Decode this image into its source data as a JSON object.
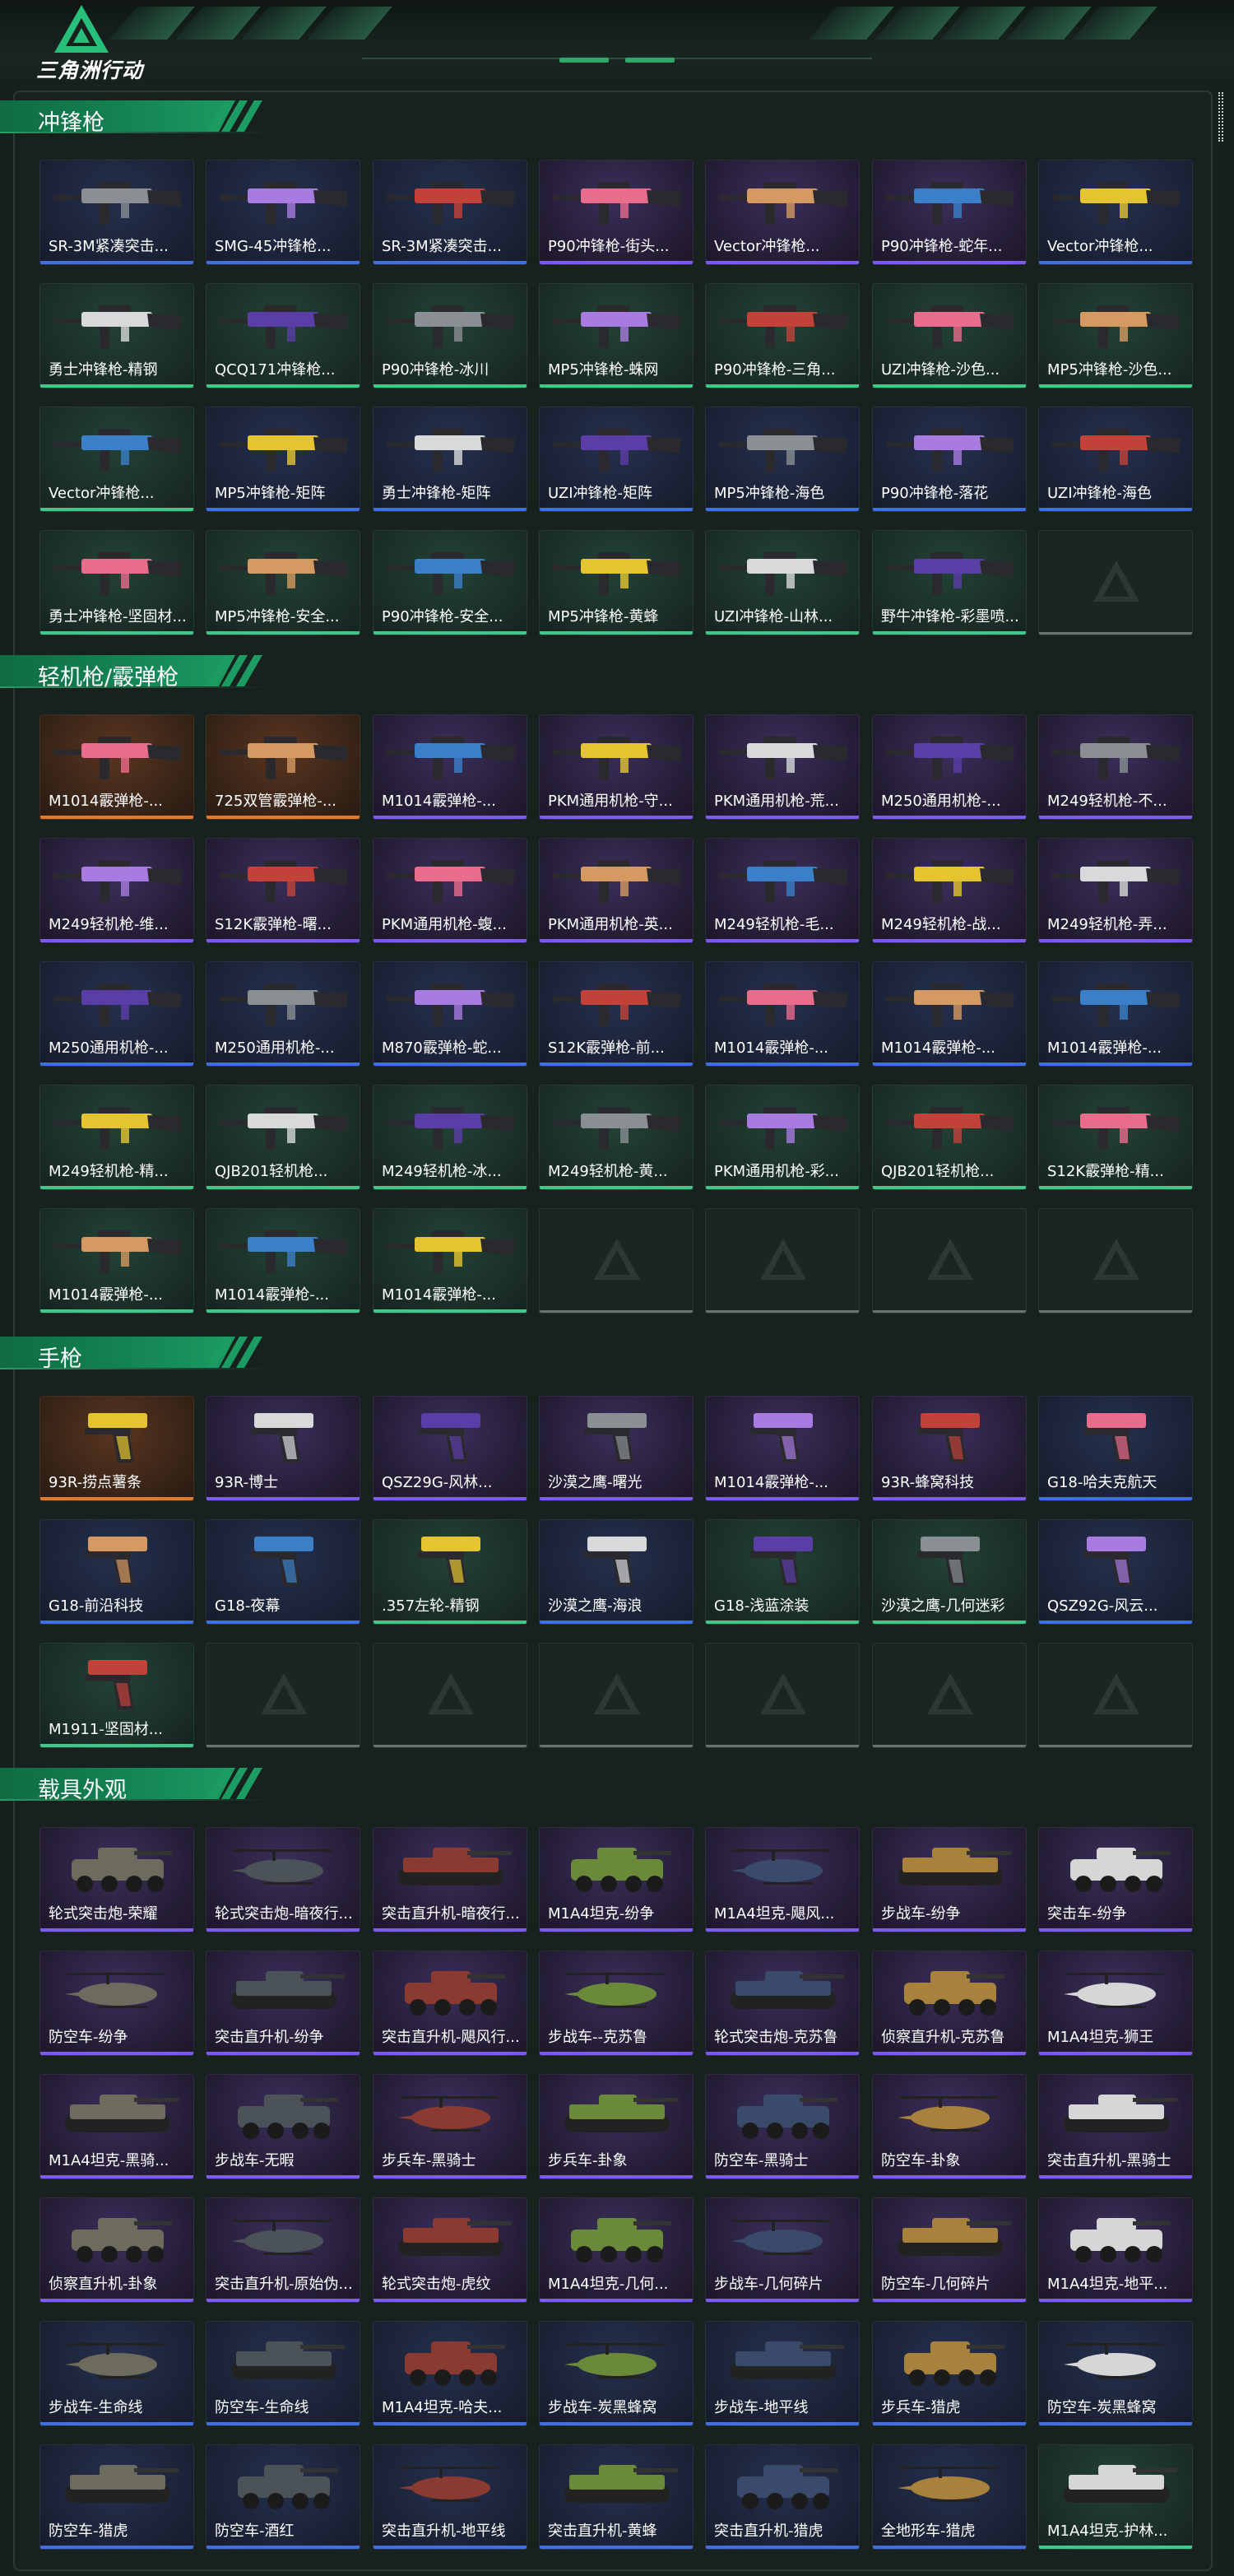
{
  "logo_text": "三角洲行动",
  "colors": {
    "purple": "#7b5cf0",
    "blue": "#3f6fe0",
    "green": "#3ec889",
    "orange": "#e27a2c",
    "accent": "#148454"
  },
  "sections": [
    {
      "title": "冲锋枪",
      "kind": "gun",
      "items": [
        {
          "label": "SR-3M紧凑突击...",
          "rarity": "blue"
        },
        {
          "label": "SMG-45冲锋枪...",
          "rarity": "blue"
        },
        {
          "label": "SR-3M紧凑突击...",
          "rarity": "blue"
        },
        {
          "label": "P90冲锋枪-街头...",
          "rarity": "purple"
        },
        {
          "label": "Vector冲锋枪...",
          "rarity": "purple"
        },
        {
          "label": "P90冲锋枪-蛇年...",
          "rarity": "purple"
        },
        {
          "label": "Vector冲锋枪...",
          "rarity": "blue"
        },
        {
          "label": "勇士冲锋枪-精钢",
          "rarity": "green"
        },
        {
          "label": "QCQ171冲锋枪...",
          "rarity": "green"
        },
        {
          "label": "P90冲锋枪-冰川",
          "rarity": "green"
        },
        {
          "label": "MP5冲锋枪-蛛网",
          "rarity": "green"
        },
        {
          "label": "P90冲锋枪-三角...",
          "rarity": "green"
        },
        {
          "label": "UZI冲锋枪-沙色...",
          "rarity": "green"
        },
        {
          "label": "MP5冲锋枪-沙色...",
          "rarity": "green"
        },
        {
          "label": "Vector冲锋枪...",
          "rarity": "green"
        },
        {
          "label": "MP5冲锋枪-矩阵",
          "rarity": "blue"
        },
        {
          "label": "勇士冲锋枪-矩阵",
          "rarity": "blue"
        },
        {
          "label": "UZI冲锋枪-矩阵",
          "rarity": "blue"
        },
        {
          "label": "MP5冲锋枪-海色",
          "rarity": "blue"
        },
        {
          "label": "P90冲锋枪-落花",
          "rarity": "blue"
        },
        {
          "label": "UZI冲锋枪-海色",
          "rarity": "blue"
        },
        {
          "label": "勇士冲锋枪-坚固材...",
          "rarity": "green"
        },
        {
          "label": "MP5冲锋枪-安全...",
          "rarity": "green"
        },
        {
          "label": "P90冲锋枪-安全...",
          "rarity": "green"
        },
        {
          "label": "MP5冲锋枪-黄蜂",
          "rarity": "green"
        },
        {
          "label": "UZI冲锋枪-山林...",
          "rarity": "green"
        },
        {
          "label": "野牛冲锋枪-彩墨喷...",
          "rarity": "green"
        },
        {
          "label": "",
          "rarity": "empty"
        }
      ]
    },
    {
      "title": "轻机枪/霰弹枪",
      "kind": "gun",
      "items": [
        {
          "label": "M1014霰弹枪-...",
          "rarity": "orange"
        },
        {
          "label": "725双管霰弹枪-...",
          "rarity": "orange"
        },
        {
          "label": "M1014霰弹枪-...",
          "rarity": "purple"
        },
        {
          "label": "PKM通用机枪-守...",
          "rarity": "purple"
        },
        {
          "label": "PKM通用机枪-荒...",
          "rarity": "purple"
        },
        {
          "label": "M250通用机枪-...",
          "rarity": "purple"
        },
        {
          "label": "M249轻机枪-不...",
          "rarity": "purple"
        },
        {
          "label": "M249轻机枪-维...",
          "rarity": "purple"
        },
        {
          "label": "S12K霰弹枪-曙...",
          "rarity": "purple"
        },
        {
          "label": "PKM通用机枪-蝮...",
          "rarity": "purple"
        },
        {
          "label": "PKM通用机枪-英...",
          "rarity": "purple"
        },
        {
          "label": "M249轻机枪-毛...",
          "rarity": "purple"
        },
        {
          "label": "M249轻机枪-战...",
          "rarity": "purple"
        },
        {
          "label": "M249轻机枪-弄...",
          "rarity": "purple"
        },
        {
          "label": "M250通用机枪-...",
          "rarity": "blue"
        },
        {
          "label": "M250通用机枪-...",
          "rarity": "blue"
        },
        {
          "label": "M870霰弹枪-蛇...",
          "rarity": "blue"
        },
        {
          "label": "S12K霰弹枪-前...",
          "rarity": "blue"
        },
        {
          "label": "M1014霰弹枪-...",
          "rarity": "blue"
        },
        {
          "label": "M1014霰弹枪-...",
          "rarity": "blue"
        },
        {
          "label": "M1014霰弹枪-...",
          "rarity": "blue"
        },
        {
          "label": "M249轻机枪-精...",
          "rarity": "green"
        },
        {
          "label": "QJB201轻机枪...",
          "rarity": "green"
        },
        {
          "label": "M249轻机枪-冰...",
          "rarity": "green"
        },
        {
          "label": "M249轻机枪-黄...",
          "rarity": "green"
        },
        {
          "label": "PKM通用机枪-彩...",
          "rarity": "green"
        },
        {
          "label": "QJB201轻机枪...",
          "rarity": "green"
        },
        {
          "label": "S12K霰弹枪-精...",
          "rarity": "green"
        },
        {
          "label": "M1014霰弹枪-...",
          "rarity": "green"
        },
        {
          "label": "M1014霰弹枪-...",
          "rarity": "green"
        },
        {
          "label": "M1014霰弹枪-...",
          "rarity": "green"
        },
        {
          "label": "",
          "rarity": "empty"
        },
        {
          "label": "",
          "rarity": "empty"
        },
        {
          "label": "",
          "rarity": "empty"
        },
        {
          "label": "",
          "rarity": "empty"
        }
      ]
    },
    {
      "title": "手枪",
      "kind": "pistol",
      "items": [
        {
          "label": "93R-捞点薯条",
          "rarity": "orange"
        },
        {
          "label": "93R-博士",
          "rarity": "purple"
        },
        {
          "label": "QSZ29G-风林...",
          "rarity": "purple"
        },
        {
          "label": "沙漠之鹰-曙光",
          "rarity": "purple"
        },
        {
          "label": "M1014霰弹枪-...",
          "rarity": "purple"
        },
        {
          "label": "93R-蜂窝科技",
          "rarity": "purple"
        },
        {
          "label": "G18-哈夫克航天",
          "rarity": "blue"
        },
        {
          "label": "G18-前沿科技",
          "rarity": "blue"
        },
        {
          "label": "G18-夜幕",
          "rarity": "blue"
        },
        {
          "label": ".357左轮-精钢",
          "rarity": "green"
        },
        {
          "label": "沙漠之鹰-海浪",
          "rarity": "blue"
        },
        {
          "label": "G18-浅蓝涂装",
          "rarity": "green"
        },
        {
          "label": "沙漠之鹰-几何迷彩",
          "rarity": "green"
        },
        {
          "label": "QSZ92G-风云...",
          "rarity": "blue"
        },
        {
          "label": "M1911-坚固材...",
          "rarity": "green"
        },
        {
          "label": "",
          "rarity": "empty"
        },
        {
          "label": "",
          "rarity": "empty"
        },
        {
          "label": "",
          "rarity": "empty"
        },
        {
          "label": "",
          "rarity": "empty"
        },
        {
          "label": "",
          "rarity": "empty"
        },
        {
          "label": "",
          "rarity": "empty"
        }
      ]
    },
    {
      "title": "载具外观",
      "kind": "vehicle",
      "items": [
        {
          "label": "轮式突击炮-荣耀",
          "rarity": "purple"
        },
        {
          "label": "轮式突击炮-暗夜行...",
          "rarity": "purple"
        },
        {
          "label": "突击直升机-暗夜行...",
          "rarity": "purple"
        },
        {
          "label": "M1A4坦克-纷争",
          "rarity": "purple"
        },
        {
          "label": "M1A4坦克-飓风...",
          "rarity": "purple"
        },
        {
          "label": "步战车-纷争",
          "rarity": "purple"
        },
        {
          "label": "突击车-纷争",
          "rarity": "purple"
        },
        {
          "label": "防空车-纷争",
          "rarity": "purple"
        },
        {
          "label": "突击直升机-纷争",
          "rarity": "purple"
        },
        {
          "label": "突击直升机-飓风行...",
          "rarity": "purple"
        },
        {
          "label": "步战车--克苏鲁",
          "rarity": "purple"
        },
        {
          "label": "轮式突击炮-克苏鲁",
          "rarity": "purple"
        },
        {
          "label": "侦察直升机-克苏鲁",
          "rarity": "purple"
        },
        {
          "label": "M1A4坦克-狮王",
          "rarity": "purple"
        },
        {
          "label": "M1A4坦克-黑骑...",
          "rarity": "purple"
        },
        {
          "label": "步战车-无暇",
          "rarity": "purple"
        },
        {
          "label": "步兵车-黑骑士",
          "rarity": "purple"
        },
        {
          "label": "步兵车-卦象",
          "rarity": "purple"
        },
        {
          "label": "防空车-黑骑士",
          "rarity": "purple"
        },
        {
          "label": "防空车-卦象",
          "rarity": "purple"
        },
        {
          "label": "突击直升机-黑骑士",
          "rarity": "purple"
        },
        {
          "label": "侦察直升机-卦象",
          "rarity": "purple"
        },
        {
          "label": "突击直升机-原始伪...",
          "rarity": "purple"
        },
        {
          "label": "轮式突击炮-虎纹",
          "rarity": "purple"
        },
        {
          "label": "M1A4坦克-几何...",
          "rarity": "purple"
        },
        {
          "label": "步战车-几何碎片",
          "rarity": "purple"
        },
        {
          "label": "防空车-几何碎片",
          "rarity": "purple"
        },
        {
          "label": "M1A4坦克-地平...",
          "rarity": "purple"
        },
        {
          "label": "步战车-生命线",
          "rarity": "blue"
        },
        {
          "label": "防空车-生命线",
          "rarity": "blue"
        },
        {
          "label": "M1A4坦克-哈夫...",
          "rarity": "blue"
        },
        {
          "label": "步战车-炭黑蜂窝",
          "rarity": "blue"
        },
        {
          "label": "步战车-地平线",
          "rarity": "blue"
        },
        {
          "label": "步兵车-猎虎",
          "rarity": "blue"
        },
        {
          "label": "防空车-炭黑蜂窝",
          "rarity": "blue"
        },
        {
          "label": "防空车-猎虎",
          "rarity": "blue"
        },
        {
          "label": "防空车-酒红",
          "rarity": "blue"
        },
        {
          "label": "突击直升机-地平线",
          "rarity": "blue"
        },
        {
          "label": "突击直升机-黄蜂",
          "rarity": "blue"
        },
        {
          "label": "突击直升机-猎虎",
          "rarity": "blue"
        },
        {
          "label": "全地形车-猎虎",
          "rarity": "blue"
        },
        {
          "label": "M1A4坦克-护林...",
          "rarity": "green"
        }
      ]
    }
  ]
}
